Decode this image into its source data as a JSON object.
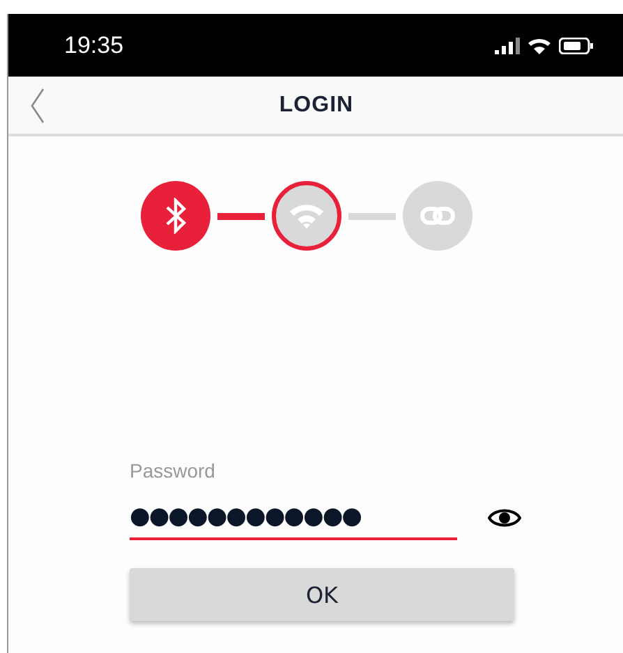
{
  "status_bar": {
    "time": "19:35"
  },
  "nav": {
    "title": "LOGIN"
  },
  "steps": [
    {
      "kind": "bluetooth",
      "done": true,
      "active": false
    },
    {
      "kind": "wifi",
      "done": false,
      "active": true
    },
    {
      "kind": "link",
      "done": false,
      "active": false
    }
  ],
  "password": {
    "label": "Password",
    "value": "●●●●●●●●●●●●",
    "focused": true
  },
  "button": "OK"
}
